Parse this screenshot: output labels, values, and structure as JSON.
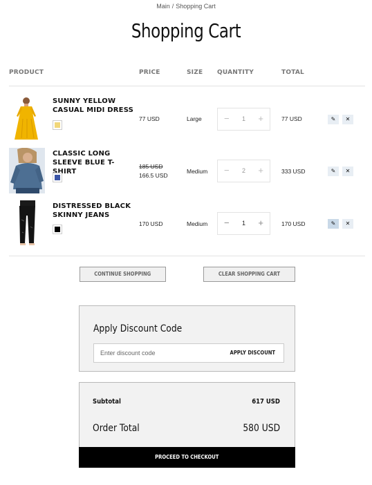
{
  "breadcrumb": {
    "home": "Main",
    "separator": "/",
    "current": "Shopping Cart"
  },
  "page_title": "Shopping Cart",
  "table": {
    "headers": {
      "product": "PRODUCT",
      "price": "PRICE",
      "size": "SIZE",
      "quantity": "QUANTITY",
      "total": "TOTAL"
    }
  },
  "items": [
    {
      "name": "SUNNY YELLOW CASUAL MIDI DRESS",
      "color": "#f1d77a",
      "price": "77 USD",
      "old_price": "",
      "size": "Large",
      "quantity": "1",
      "total": "77 USD"
    },
    {
      "name": "CLASSIC LONG SLEEVE BLUE T-SHIRT",
      "color": "#3b55a6",
      "price": "166.5 USD",
      "old_price": "185 USD",
      "size": "Medium",
      "quantity": "2",
      "total": "333 USD"
    },
    {
      "name": "DISTRESSED BLACK SKINNY JEANS",
      "color": "#000000",
      "price": "170 USD",
      "old_price": "",
      "size": "Medium",
      "quantity": "1",
      "total": "170 USD"
    }
  ],
  "icons": {
    "edit": "pencil-icon",
    "remove": "close-icon",
    "minus": "minus-icon",
    "plus": "plus-icon"
  },
  "glyphs": {
    "minus": "−",
    "plus": "+",
    "edit": "✎",
    "remove": "✕"
  },
  "actions": {
    "continue": "CONTINUE SHOPPING",
    "clear": "CLEAR SHOPPING CART"
  },
  "discount": {
    "title": "Apply Discount Code",
    "placeholder": "Enter discount code",
    "button": "APPLY DISCOUNT"
  },
  "summary": {
    "subtotal_label": "Subtotal",
    "subtotal_value": "617 USD",
    "order_total_label": "Order Total",
    "order_total_value": "580 USD",
    "checkout": "PROCEED TO CHECKOUT"
  }
}
